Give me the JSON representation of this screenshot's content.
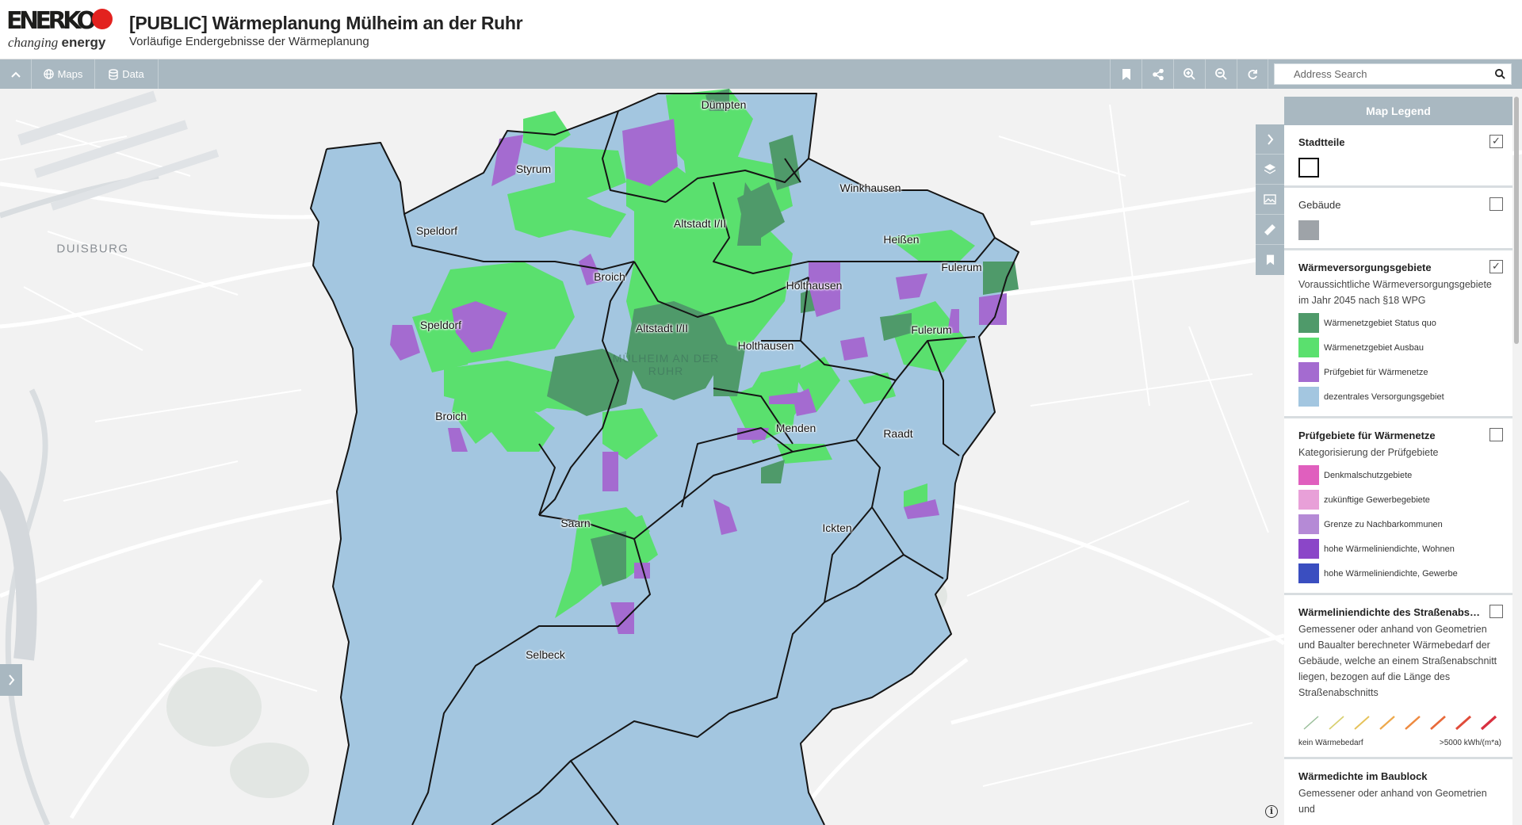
{
  "header": {
    "logo_text": "ENERKO",
    "tagline_prefix": "changing",
    "tagline_suffix": "energy",
    "title": "[PUBLIC] Wärmeplanung Mülheim an der Ruhr",
    "subtitle": "Vorläufige Endergebnisse der Wärmeplanung"
  },
  "toolbar": {
    "collapse_icon": "chevron-up-icon",
    "maps_label": "Maps",
    "maps_icon": "globe-icon",
    "data_label": "Data",
    "data_icon": "database-icon",
    "right_icons": [
      "bookmark-icon",
      "share-icon",
      "zoom-in-icon",
      "zoom-out-icon",
      "refresh-icon"
    ],
    "search_placeholder": "Address Search",
    "search_icon": "search-icon"
  },
  "map": {
    "city_label": "DUISBURG",
    "center_label_line1": "MÜLHEIM AN DER",
    "center_label_line2": "RUHR",
    "district_labels": {
      "duempten": "Dümpten",
      "styrum": "Styrum",
      "winkhausen": "Winkhausen",
      "speldorf_1": "Speldorf",
      "altstadt_1": "Altstadt I/II",
      "heissen": "Heißen",
      "broich_1": "Broich",
      "fulerum_1": "Fulerum",
      "holthausen_1": "Holthausen",
      "speldorf_2": "Speldorf",
      "altstadt_2": "Altstadt I/II",
      "fulerum_2": "Fulerum",
      "holthausen_2": "Holthausen",
      "broich_2": "Broich",
      "menden": "Menden",
      "raadt": "Raadt",
      "saarn": "Saarn",
      "ickten": "Ickten",
      "selbeck": "Selbeck"
    },
    "colors": {
      "status_quo": "#4f9a6a",
      "ausbau": "#5ae06e",
      "pruefgebiet": "#a46bd0",
      "dezentral": "#a3c6e0"
    }
  },
  "side_tools": [
    "chevron-right-icon",
    "layers-icon",
    "image-icon",
    "ruler-icon",
    "bookmark-icon"
  ],
  "legend": {
    "header": "Map Legend",
    "sections": [
      {
        "title": "Stadtteile",
        "checked": "✓",
        "items": []
      },
      {
        "title": "Gebäude",
        "checked": ""
      },
      {
        "title": "Wärmeversorgungsgebiete",
        "checked": "✓",
        "desc": "Voraussichtliche Wärmeversorgungsgebiete im Jahr 2045 nach §18 WPG",
        "items": [
          {
            "label": "Wärmenetzgebiet Status quo",
            "color": "#4f9a6a"
          },
          {
            "label": "Wärmenetzgebiet Ausbau",
            "color": "#5ae06e"
          },
          {
            "label": "Prüfgebiet für Wärmenetze",
            "color": "#a46bd0"
          },
          {
            "label": "dezentrales Versorgungsgebiet",
            "color": "#a3c6e0"
          }
        ]
      },
      {
        "title": "Prüfgebiete für Wärmenetze",
        "checked": "",
        "desc": "Kategorisierung der Prüfgebiete",
        "items": [
          {
            "label": "Denkmalschutzgebiete",
            "color": "#e05fbe"
          },
          {
            "label": "zukünftige Gewerbegebiete",
            "color": "#e8a0d8"
          },
          {
            "label": "Grenze zu Nachbarkommunen",
            "color": "#b58ad6"
          },
          {
            "label": "hohe Wärmeliniendichte, Wohnen",
            "color": "#8b46c8"
          },
          {
            "label": "hohe Wärmeliniendichte, Gewerbe",
            "color": "#3a4ec0"
          }
        ]
      },
      {
        "title": "Wärmeliniendichte des Straßenabschnitts",
        "checked": "",
        "desc": "Gemessener oder anhand von Geometrien und Baualter berechneter Wärmebedarf der Gebäude, welche an einem Straßenabschnitt liegen, bezogen auf die Länge des Straßenabschnitts",
        "ramp_colors": [
          "#9bbf9b",
          "#d8d070",
          "#e6c25a",
          "#eea94c",
          "#ee8a40",
          "#e86a3a",
          "#e04c3a",
          "#d83040"
        ],
        "ramp_min_label": "kein Wärmebedarf",
        "ramp_max_label": ">5000 kWh/(m*a)"
      },
      {
        "title": "Wärmedichte im Baublock",
        "checked": "",
        "desc": "Gemessener oder anhand von Geometrien und"
      }
    ]
  },
  "info_icon": "info-icon"
}
